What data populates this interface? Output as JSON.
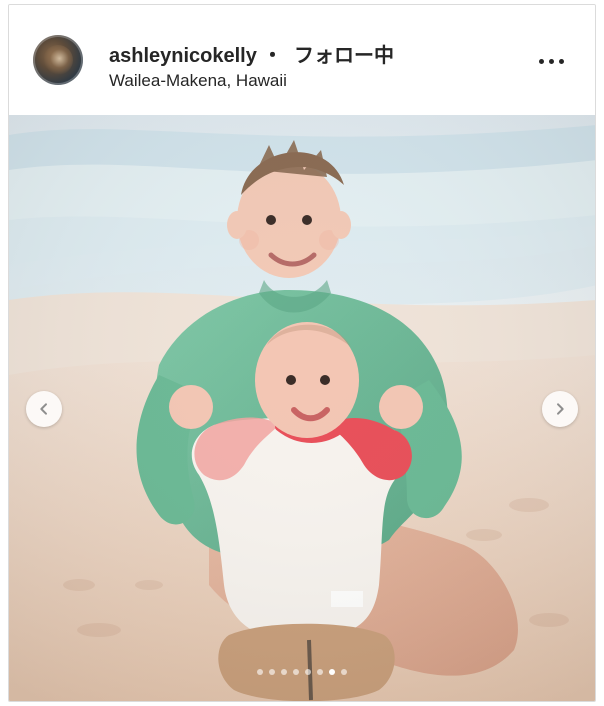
{
  "post": {
    "username": "ashleynicokelly",
    "separator": "・",
    "follow_status": "フォロー中",
    "location": "Wailea-Makena, Hawaii"
  },
  "icons": {
    "more": "more-horizontal-icon",
    "prev": "chevron-left-icon",
    "next": "chevron-right-icon"
  },
  "carousel": {
    "current_index": 7,
    "total": 8
  },
  "colors": {
    "text": "#262626",
    "border": "#dbdbdb"
  }
}
